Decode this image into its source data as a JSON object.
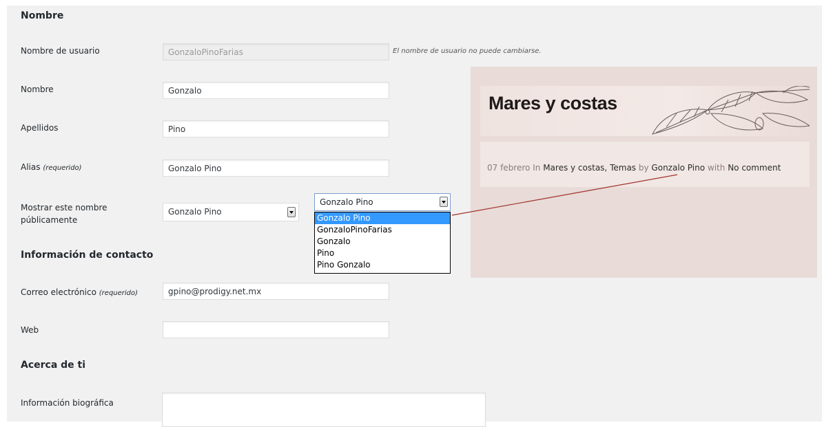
{
  "sections": {
    "name": "Nombre",
    "contact": "Información de contacto",
    "about": "Acerca de ti"
  },
  "fields": {
    "username": {
      "label": "Nombre de usuario",
      "value": "GonzaloPinoFarias",
      "description": "El nombre de usuario no puede cambiarse."
    },
    "first_name": {
      "label": "Nombre",
      "value": "Gonzalo"
    },
    "last_name": {
      "label": "Apellidos",
      "value": "Pino"
    },
    "nickname": {
      "label": "Alias",
      "required": "(requerido)",
      "value": "Gonzalo Pino"
    },
    "display_name": {
      "label_line1": "Mostrar este nombre",
      "label_line2": "públicamente",
      "value": "Gonzalo Pino",
      "dropdown_value": "Gonzalo Pino",
      "options": [
        "Gonzalo Pino",
        "GonzaloPinoFarias",
        "Gonzalo",
        "Pino",
        "Pino Gonzalo"
      ],
      "selected_index": 0
    },
    "email": {
      "label": "Correo electrónico",
      "required": "(requerido)",
      "value": "gpino@prodigy.net.mx"
    },
    "web": {
      "label": "Web",
      "value": ""
    },
    "bio": {
      "label": "Información biográfica",
      "value": ""
    }
  },
  "preview": {
    "title": "Mares y costas",
    "date": "07 febrero",
    "in_word": "In",
    "category1": "Mares y costas,",
    "category2": "Temas",
    "by_word": "by",
    "author": "Gonzalo Pino",
    "with_word": "with",
    "comments": "No comment"
  },
  "colors": {
    "panel_bg": "#f1f1f1",
    "preview_bg": "#e8dbd8",
    "selected_option": "#3399ff",
    "connector_line": "#a0302a"
  }
}
